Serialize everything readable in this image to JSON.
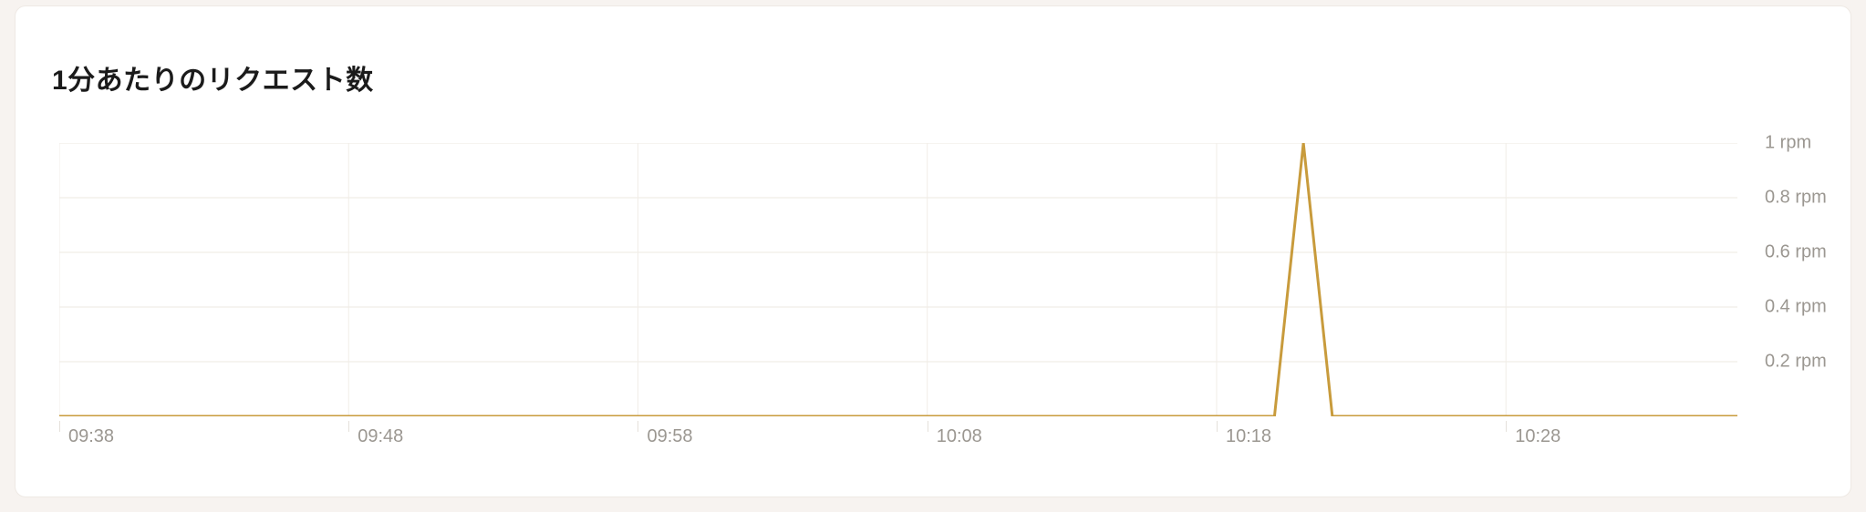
{
  "title": "1分あたりのリクエスト数",
  "chart_data": {
    "type": "line",
    "title": "1分あたりのリクエスト数",
    "xlabel": "",
    "ylabel": "",
    "y_unit": "rpm",
    "ylim": [
      0,
      1
    ],
    "x_ticks": [
      "09:38",
      "09:48",
      "09:58",
      "10:08",
      "10:18",
      "10:28"
    ],
    "y_ticks": [
      0.2,
      0.4,
      0.6,
      0.8,
      1
    ],
    "y_tick_labels": [
      "0.2 rpm",
      "0.4 rpm",
      "0.6 rpm",
      "0.8 rpm",
      "1 rpm"
    ],
    "series": [
      {
        "name": "requests",
        "color": "#c89b3c",
        "x": [
          "09:38",
          "09:39",
          "09:40",
          "09:41",
          "09:42",
          "09:43",
          "09:44",
          "09:45",
          "09:46",
          "09:47",
          "09:48",
          "09:49",
          "09:50",
          "09:51",
          "09:52",
          "09:53",
          "09:54",
          "09:55",
          "09:56",
          "09:57",
          "09:58",
          "09:59",
          "10:00",
          "10:01",
          "10:02",
          "10:03",
          "10:04",
          "10:05",
          "10:06",
          "10:07",
          "10:08",
          "10:09",
          "10:10",
          "10:11",
          "10:12",
          "10:13",
          "10:14",
          "10:15",
          "10:16",
          "10:17",
          "10:18",
          "10:19",
          "10:20",
          "10:21",
          "10:22",
          "10:23",
          "10:24",
          "10:25",
          "10:26",
          "10:27",
          "10:28",
          "10:29",
          "10:30",
          "10:31",
          "10:32",
          "10:33",
          "10:34",
          "10:35",
          "10:36"
        ],
        "values": [
          0,
          0,
          0,
          0,
          0,
          0,
          0,
          0,
          0,
          0,
          0,
          0,
          0,
          0,
          0,
          0,
          0,
          0,
          0,
          0,
          0,
          0,
          0,
          0,
          0,
          0,
          0,
          0,
          0,
          0,
          0,
          0,
          0,
          0,
          0,
          0,
          0,
          0,
          0,
          0,
          0,
          0,
          0,
          1,
          0,
          0,
          0,
          0,
          0,
          0,
          0,
          0,
          0,
          0,
          0,
          0,
          0,
          0,
          0
        ]
      }
    ]
  }
}
